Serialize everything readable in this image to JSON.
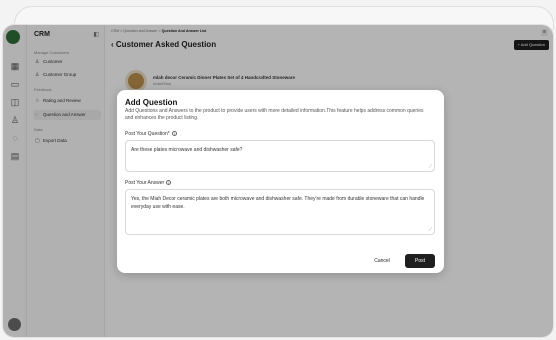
{
  "sidebar": {
    "brand": "CRM",
    "section_manage": "Manage Customers",
    "item_customer": "Customer",
    "item_customer_group": "Customer Group",
    "section_feedback": "Feedback",
    "item_rating": "Rating and Review",
    "item_qa": "Question and Answer",
    "section_data": "Data",
    "item_export": "Export Data"
  },
  "header": {
    "breadcrumb_root": "CRM",
    "breadcrumb_mid": "Question and Answer",
    "breadcrumb_current": "Question And Answer List",
    "title": "Customer Asked Question",
    "add_button": "+ Add Question",
    "back_icon": "‹"
  },
  "product": {
    "title": "mlah decor Ceramic Dinner Plates Set of 4 Handcrafted Stoneware",
    "subtitle": "Mulah/Total"
  },
  "modal": {
    "title": "Add Question",
    "description": "Add Questions and Answers to the product to provide users with more detailed information.This feature helps address common queries and enhances the product listing.",
    "question_label": "Post Your Question*",
    "question_value": "Are these plates microwave and dishwasher safe?",
    "answer_label": "Post Your Answer",
    "answer_value": "Yes, the Miah Decor ceramic plates are both microwave and dishwasher safe. They're made from durable stoneware that can handle everyday use with ease.",
    "cancel_label": "Cancel",
    "post_label": "Post"
  }
}
